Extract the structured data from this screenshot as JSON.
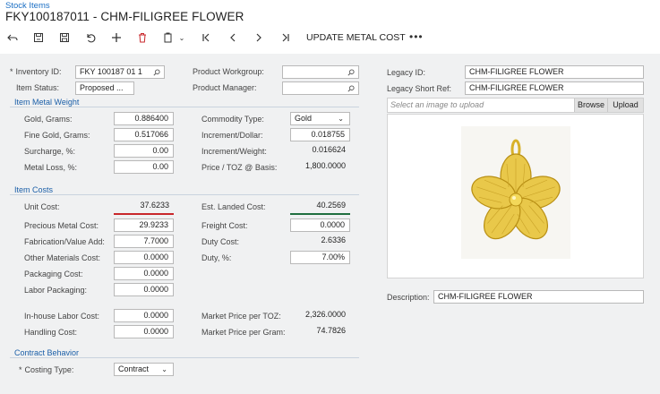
{
  "header": {
    "breadcrumb": "Stock Items",
    "title": "FKY100187011 - CHM-FILIGREE FLOWER"
  },
  "toolbar": {
    "update_metal_cost": "UPDATE METAL COST",
    "more": "•••"
  },
  "general": {
    "inventory_id_label": "Inventory ID:",
    "inventory_id_value": "FKY 100187 01 1",
    "item_status_label": "Item Status:",
    "item_status_value": "Proposed ...",
    "product_workgroup_label": "Product Workgroup:",
    "product_workgroup_value": "",
    "product_manager_label": "Product Manager:",
    "product_manager_value": ""
  },
  "item_metal_weight": {
    "title": "Item Metal Weight",
    "gold_grams_label": "Gold, Grams:",
    "gold_grams_value": "0.886400",
    "fine_gold_label": "Fine Gold, Grams:",
    "fine_gold_value": "0.517066",
    "surcharge_label": "Surcharge, %:",
    "surcharge_value": "0.00",
    "metal_loss_label": "Metal Loss, %:",
    "metal_loss_value": "0.00",
    "commodity_type_label": "Commodity Type:",
    "commodity_type_value": "Gold",
    "increment_dollar_label": "Increment/Dollar:",
    "increment_dollar_value": "0.018755",
    "increment_weight_label": "Increment/Weight:",
    "increment_weight_value": "0.016624",
    "price_toz_label": "Price / TOZ @ Basis:",
    "price_toz_value": "1,800.0000"
  },
  "item_costs": {
    "title": "Item Costs",
    "unit_cost_label": "Unit Cost:",
    "unit_cost_value": "37.6233",
    "precious_metal_label": "Precious Metal Cost:",
    "precious_metal_value": "29.9233",
    "fabrication_label": "Fabrication/Value Add:",
    "fabrication_value": "7.7000",
    "other_materials_label": "Other Materials Cost:",
    "other_materials_value": "0.0000",
    "packaging_label": "Packaging Cost:",
    "packaging_value": "0.0000",
    "labor_packaging_label": "Labor Packaging:",
    "labor_packaging_value": "0.0000",
    "inhouse_labor_label": "In-house Labor Cost:",
    "inhouse_labor_value": "0.0000",
    "handling_label": "Handling Cost:",
    "handling_value": "0.0000",
    "est_landed_label": "Est. Landed Cost:",
    "est_landed_value": "40.2569",
    "freight_label": "Freight Cost:",
    "freight_value": "0.0000",
    "duty_cost_label": "Duty Cost:",
    "duty_cost_value": "2.6336",
    "duty_pct_label": "Duty, %:",
    "duty_pct_value": "7.00%",
    "market_toz_label": "Market Price per TOZ:",
    "market_toz_value": "2,326.0000",
    "market_gram_label": "Market Price per Gram:",
    "market_gram_value": "74.7826"
  },
  "contract_behavior": {
    "title": "Contract Behavior",
    "costing_type_label": "Costing Type:",
    "costing_type_value": "Contract"
  },
  "right": {
    "legacy_id_label": "Legacy ID:",
    "legacy_id_value": "CHM-FILIGREE FLOWER",
    "legacy_short_label": "Legacy Short Ref:",
    "legacy_short_value": "CHM-FILIGREE FLOWER",
    "image_placeholder": "Select an image to upload",
    "browse_label": "Browse",
    "upload_label": "Upload",
    "description_label": "Description:",
    "description_value": "CHM-FILIGREE FLOWER"
  },
  "colors": {
    "link_blue": "#1b6fc4",
    "unit_cost_underline": "#c8272b",
    "landed_cost_underline": "#1f6e3f",
    "gold": "#e6c33a"
  },
  "icons": [
    "undo-icon",
    "save-close-icon",
    "save-icon",
    "revert-icon",
    "add-icon",
    "delete-icon",
    "copy-paste-icon",
    "first-icon",
    "previous-icon",
    "next-icon",
    "last-icon",
    "search-icon",
    "chevron-down-icon"
  ]
}
